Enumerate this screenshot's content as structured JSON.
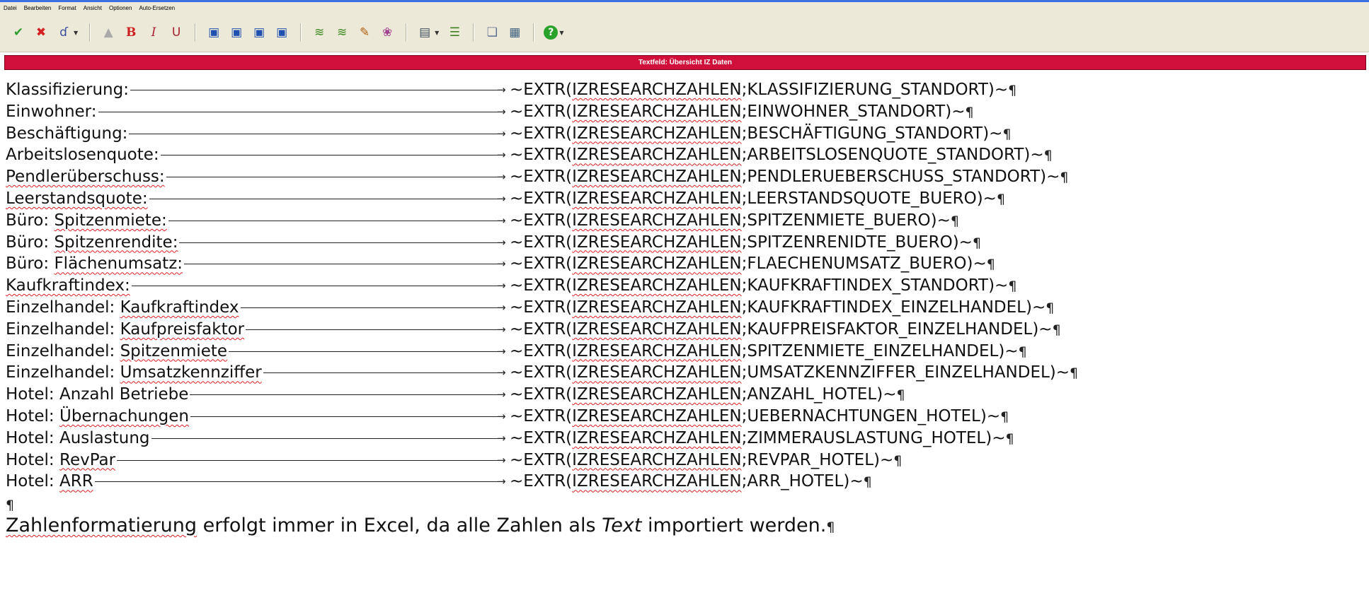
{
  "menu": [
    "Datei",
    "Bearbeiten",
    "Format",
    "Ansicht",
    "Optionen",
    "Auto-Ersetzen"
  ],
  "toolbar_icons": [
    {
      "name": "check-icon",
      "glyph": "✔",
      "color": "#2e9c2e"
    },
    {
      "name": "cancel-icon",
      "glyph": "✖",
      "color": "#d42020"
    },
    {
      "name": "brush-icon",
      "glyph": "ɗ",
      "color": "#3a4fa0"
    },
    {
      "name": "stamp-icon",
      "glyph": "▲",
      "color": "#aaaaaa"
    },
    {
      "name": "bold-icon",
      "glyph": "B",
      "color": "#cc2020"
    },
    {
      "name": "italic-icon",
      "glyph": "I",
      "color": "#aa2030"
    },
    {
      "name": "underline-icon",
      "glyph": "U",
      "color": "#aa2030"
    },
    {
      "name": "view1-icon",
      "glyph": "▣",
      "color": "#2050b0"
    },
    {
      "name": "view2-icon",
      "glyph": "▣",
      "color": "#2050b0"
    },
    {
      "name": "view3-icon",
      "glyph": "▣",
      "color": "#2050b0"
    },
    {
      "name": "view4-icon",
      "glyph": "▣",
      "color": "#2050b0"
    },
    {
      "name": "field1-icon",
      "glyph": "≋",
      "color": "#3c8a20"
    },
    {
      "name": "field2-icon",
      "glyph": "≋",
      "color": "#3c8a20"
    },
    {
      "name": "field3-icon",
      "glyph": "✎",
      "color": "#b06010"
    },
    {
      "name": "field4-icon",
      "glyph": "❀",
      "color": "#a04090"
    },
    {
      "name": "table-icon",
      "glyph": "▤",
      "color": "#405060"
    },
    {
      "name": "list-icon",
      "glyph": "☰",
      "color": "#408020"
    },
    {
      "name": "doc-icon",
      "glyph": "❏",
      "color": "#607090"
    },
    {
      "name": "paste-icon",
      "glyph": "▦",
      "color": "#406080"
    },
    {
      "name": "help-icon",
      "glyph": "?",
      "color": "#ffffff"
    }
  ],
  "panel_title": "Textfeld: Übersicht IZ Daten",
  "rows": [
    {
      "pre": "Klassifizierung:",
      "und": "",
      "field": "KLASSIFIZIERUNG_STANDORT"
    },
    {
      "pre": "Einwohner:",
      "und": "",
      "field": "EINWOHNER_STANDORT"
    },
    {
      "pre": "Beschäftigung:",
      "und": "",
      "field": "BESCHÄFTIGUNG_STANDORT"
    },
    {
      "pre": "Arbeitslosenquote:",
      "und": "",
      "field": "ARBEITSLOSENQUOTE_STANDORT"
    },
    {
      "pre": "",
      "und": "Pendlerüberschuss:",
      "field": "PENDLERUEBERSCHUSS_STANDORT"
    },
    {
      "pre": "",
      "und": "Leerstandsquote:",
      "field": "LEERSTANDSQUOTE_BUERO"
    },
    {
      "pre": "Büro: ",
      "und": "Spitzenmiete:",
      "field": "SPITZENMIETE_BUERO"
    },
    {
      "pre": "Büro: ",
      "und": "Spitzenrendite:",
      "field": "SPITZENRENIDTE_BUERO"
    },
    {
      "pre": "Büro: ",
      "und": "Flächenumsatz:",
      "field": "FLAECHENUMSATZ_BUERO"
    },
    {
      "pre": "",
      "und": "Kaufkraftindex:",
      "field": "KAUFKRAFTINDEX_STANDORT"
    },
    {
      "pre": "Einzelhandel: ",
      "und": "Kaufkraftindex",
      "field": "KAUFKRAFTINDEX_EINZELHANDEL"
    },
    {
      "pre": "Einzelhandel: ",
      "und": "Kaufpreisfaktor",
      "field": "KAUFPREISFAKTOR_EINZELHANDEL"
    },
    {
      "pre": "Einzelhandel: ",
      "und": "Spitzenmiete",
      "field": "SPITZENMIETE_EINZELHANDEL"
    },
    {
      "pre": "Einzelhandel: ",
      "und": "Umsatzkennziffer",
      "field": "UMSATZKENNZIFFER_EINZELHANDEL"
    },
    {
      "pre": "Hotel: Anzahl Betriebe",
      "und": "",
      "field": "ANZAHL_HOTEL"
    },
    {
      "pre": "Hotel: ",
      "und": "Übernachungen",
      "field": "UEBERNACHTUNGEN_HOTEL"
    },
    {
      "pre": "Hotel: Auslastung",
      "und": "",
      "field": "ZIMMERAUSLASTUNG_HOTEL"
    },
    {
      "pre": "Hotel: ",
      "und": "RevPar",
      "field": "REVPAR_HOTEL"
    },
    {
      "pre": "Hotel: ",
      "und": "ARR",
      "field": "ARR_HOTEL"
    }
  ],
  "formula_prefix": "~EXTR(",
  "formula_source": "IZRESEARCHZAHLEN",
  "formula_suffix": ")~",
  "pilcrow": "¶",
  "note": {
    "part1": "Zahlenformatierung",
    "part2": " erfolgt immer in Excel, da alle Zahlen als ",
    "italic": "Text",
    "part3": " importiert werden."
  }
}
